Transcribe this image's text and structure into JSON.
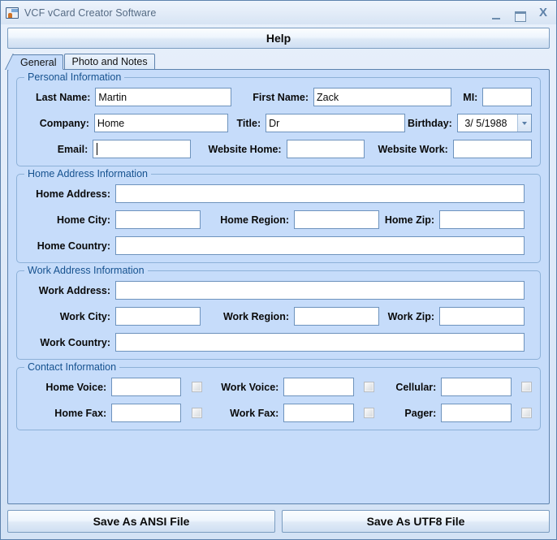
{
  "window": {
    "title": "VCF vCard Creator Software",
    "icon": "vcard-contact-icon",
    "controls": {
      "minimize": "–",
      "maximize": "□",
      "close": "X"
    }
  },
  "toolbar": {
    "help_label": "Help"
  },
  "tabs": [
    {
      "label": "General",
      "active": true
    },
    {
      "label": "Photo and Notes",
      "active": false
    }
  ],
  "groups": {
    "personal": {
      "legend": "Personal Information",
      "last_name": {
        "label": "Last Name:",
        "value": "Martin"
      },
      "first_name": {
        "label": "First Name:",
        "value": "Zack"
      },
      "mi": {
        "label": "MI:",
        "value": ""
      },
      "company": {
        "label": "Company:",
        "value": "Home"
      },
      "title": {
        "label": "Title:",
        "value": "Dr"
      },
      "birthday": {
        "label": "Birthday:",
        "value": "3/  5/1988"
      },
      "email": {
        "label": "Email:",
        "value": ""
      },
      "website_home": {
        "label": "Website Home:",
        "value": ""
      },
      "website_work": {
        "label": "Website Work:",
        "value": ""
      }
    },
    "home_address": {
      "legend": "Home Address Information",
      "address": {
        "label": "Home Address:",
        "value": ""
      },
      "city": {
        "label": "Home City:",
        "value": ""
      },
      "region": {
        "label": "Home Region:",
        "value": ""
      },
      "zip": {
        "label": "Home Zip:",
        "value": ""
      },
      "country": {
        "label": "Home Country:",
        "value": ""
      }
    },
    "work_address": {
      "legend": "Work Address Information",
      "address": {
        "label": "Work Address:",
        "value": ""
      },
      "city": {
        "label": "Work City:",
        "value": ""
      },
      "region": {
        "label": "Work Region:",
        "value": ""
      },
      "zip": {
        "label": "Work Zip:",
        "value": ""
      },
      "country": {
        "label": "Work Country:",
        "value": ""
      }
    },
    "contact": {
      "legend": "Contact Information",
      "home_voice": {
        "label": "Home Voice:",
        "value": "",
        "checked": false
      },
      "work_voice": {
        "label": "Work Voice:",
        "value": "",
        "checked": false
      },
      "cellular": {
        "label": "Cellular:",
        "value": "",
        "checked": false
      },
      "home_fax": {
        "label": "Home Fax:",
        "value": "",
        "checked": false
      },
      "work_fax": {
        "label": "Work Fax:",
        "value": "",
        "checked": false
      },
      "pager": {
        "label": "Pager:",
        "value": "",
        "checked": false
      }
    }
  },
  "footer": {
    "save_ansi_label": "Save As ANSI File",
    "save_utf8_label": "Save As UTF8 File"
  },
  "colors": {
    "panel_bg": "#c6dcfa",
    "panel_border": "#5d82ad",
    "group_border": "#8db1d8",
    "legend_text": "#16528f",
    "field_border": "#6e93bd",
    "title_text": "#556b84"
  }
}
